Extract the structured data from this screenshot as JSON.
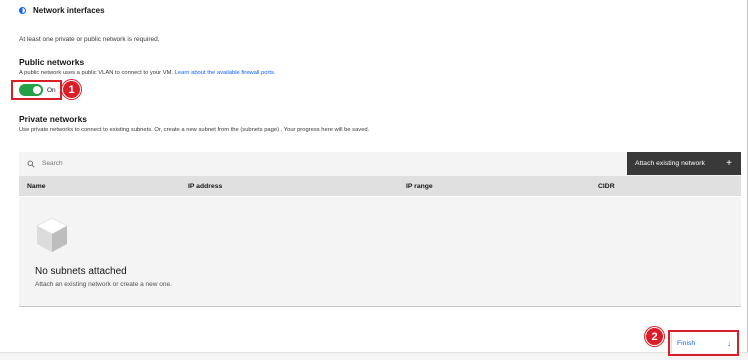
{
  "section": {
    "title": "Network interfaces",
    "icon": "half-circle-icon"
  },
  "hint": "At least one private or public network is required.",
  "public_networks": {
    "title": "Public networks",
    "helper_text": "A public network uses a public VLAN to connect to your VM.",
    "helper_link": "Learn about the available firewall ports.",
    "toggle_label": "On",
    "toggle_state": true
  },
  "private_networks": {
    "title": "Private networks",
    "helper_text": "Use private networks to connect to existing subnets. Or, create a new subnet from the (subnets page) . Your progress here will be saved."
  },
  "table": {
    "search_placeholder": "Search",
    "attach_button": "Attach existing network",
    "attach_icon": "+",
    "columns": [
      "Name",
      "IP address",
      "IP range",
      "CIDR"
    ],
    "rows": [],
    "empty_title": "No subnets attached",
    "empty_subtitle": "Attach an existing network or create a new one."
  },
  "footer": {
    "finish_label": "Finish",
    "finish_icon": "↓"
  },
  "annotations": {
    "step1": "1",
    "step2": "2"
  },
  "colors": {
    "toggle_on": "#24a148",
    "primary_button": "#393939",
    "link": "#0f62fe",
    "annotation": "#da1e28"
  }
}
